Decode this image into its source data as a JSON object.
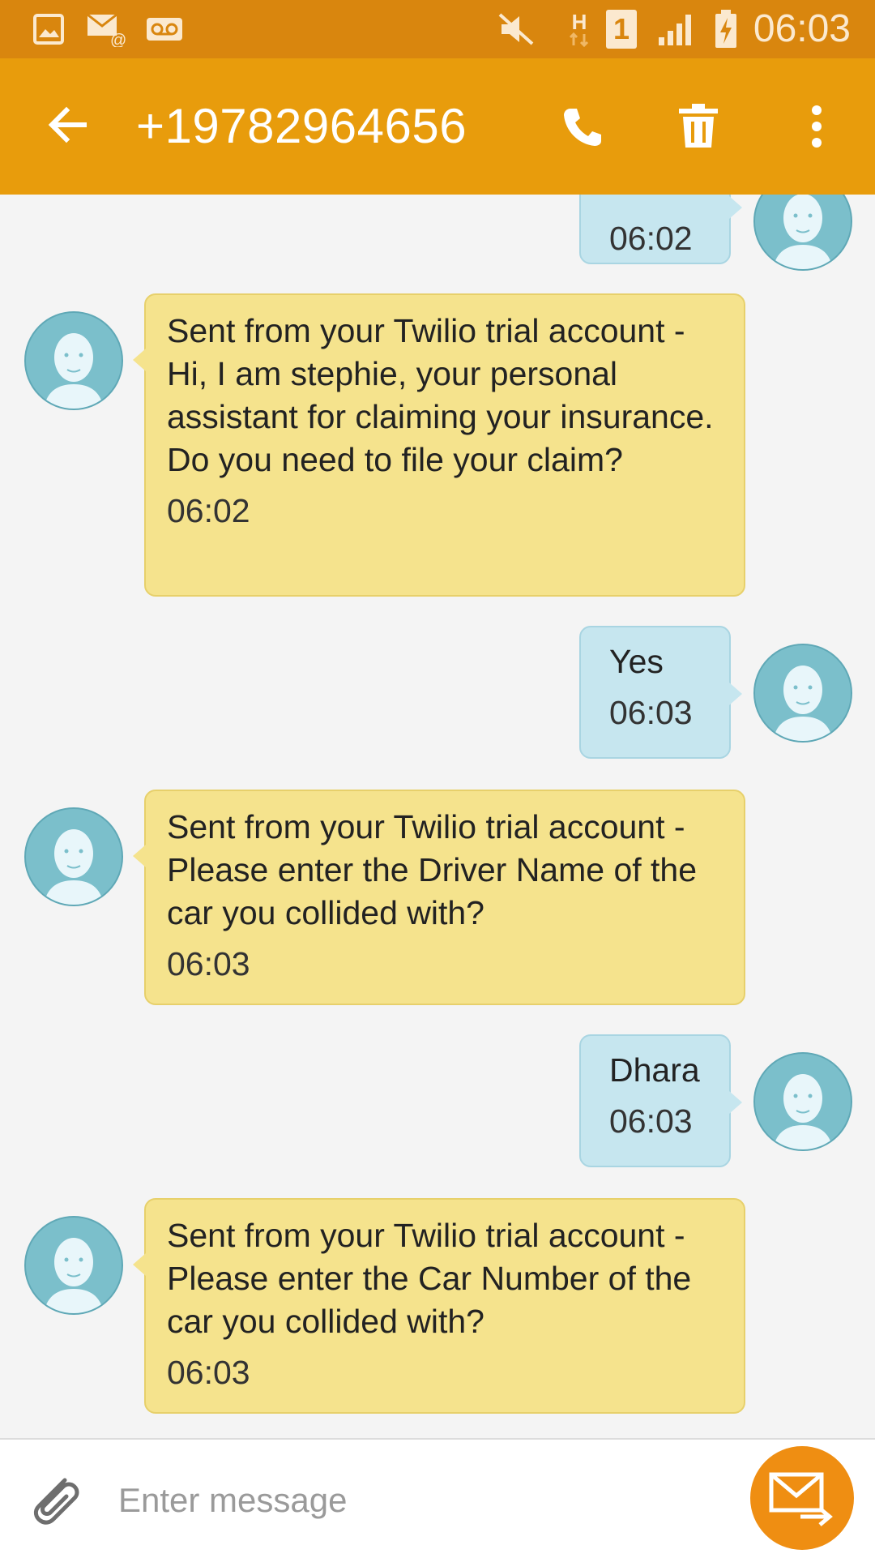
{
  "status_bar": {
    "time": "06:03",
    "network_type": "H",
    "sim_slot": "1",
    "icons": [
      "gallery-icon",
      "email-icon",
      "voicemail-icon",
      "mute-icon",
      "data-arrows-icon",
      "sim-icon",
      "signal-icon",
      "battery-charging-icon"
    ]
  },
  "app_bar": {
    "title": "+19782964656",
    "icons": [
      "back-arrow-icon",
      "phone-icon",
      "trash-icon",
      "overflow-menu-icon"
    ]
  },
  "conversation": {
    "messages": [
      {
        "direction": "outgoing",
        "text": "",
        "time": "06:02"
      },
      {
        "direction": "incoming",
        "text": "Sent from your Twilio trial account - Hi, I am stephie, your personal assistant for claiming your insurance. Do you need to file your claim?",
        "time": "06:02"
      },
      {
        "direction": "outgoing",
        "text": "Yes",
        "time": "06:03"
      },
      {
        "direction": "incoming",
        "text": "Sent from your Twilio trial account - Please enter the Driver Name of the car you collided with?",
        "time": "06:03"
      },
      {
        "direction": "outgoing",
        "text": "Dhara",
        "time": "06:03"
      },
      {
        "direction": "incoming",
        "text": "Sent from your Twilio trial account - Please enter the Car Number of the car you collided with?",
        "time": "06:03"
      }
    ]
  },
  "composer": {
    "placeholder": "Enter message",
    "icons": [
      "paperclip-icon",
      "send-message-icon"
    ]
  },
  "colors": {
    "status_bar": "#d9860e",
    "app_bar": "#e89c0c",
    "incoming_bubble": "#f5e38d",
    "outgoing_bubble": "#c6e6ef",
    "avatar": "#7bbfcb",
    "send_button": "#ef8e12"
  }
}
